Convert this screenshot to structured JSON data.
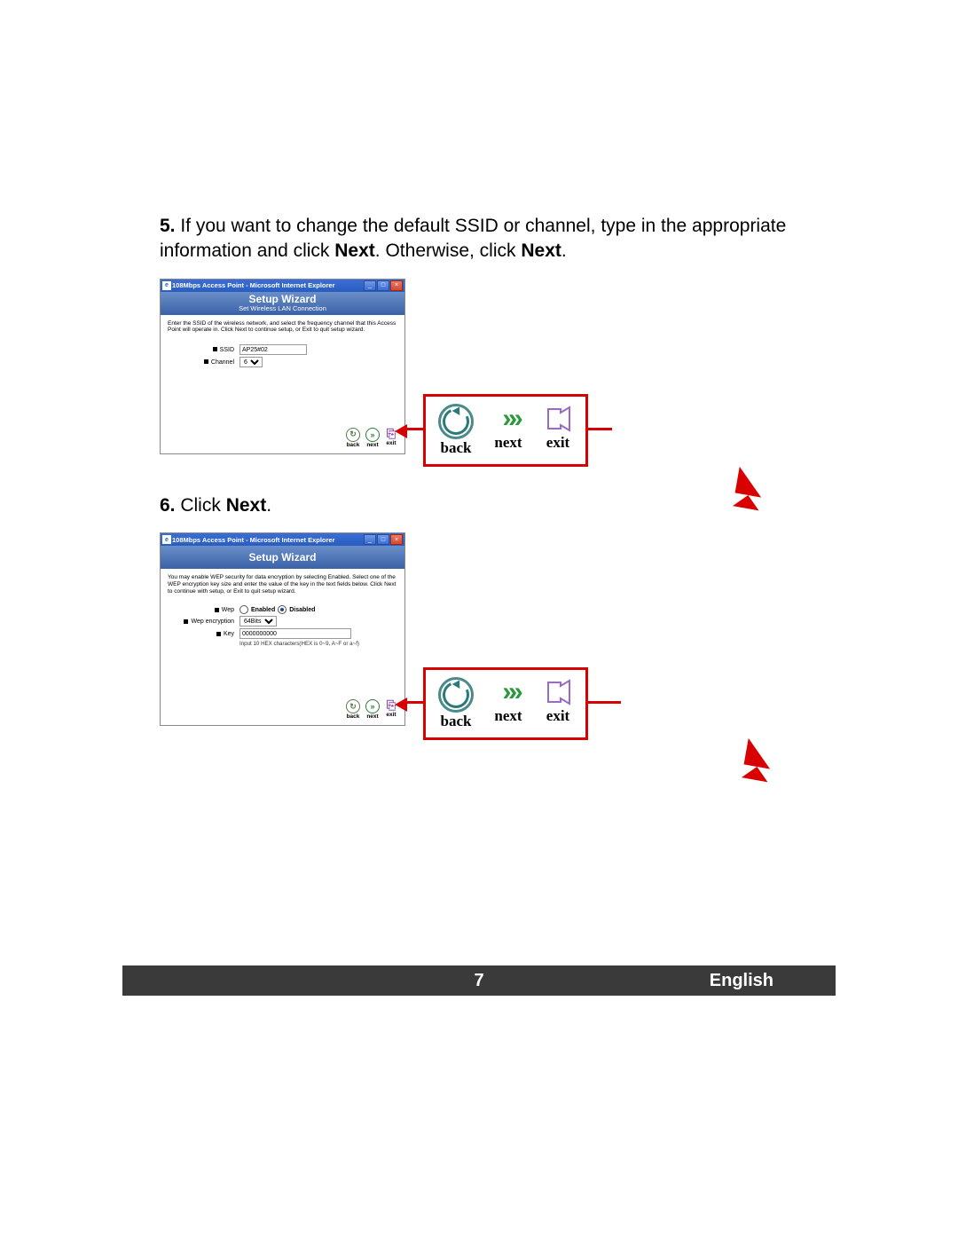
{
  "step5": {
    "number": "5.",
    "text_pre": " If you want to change the default SSID or channel, type in the appropriate information and click ",
    "bold1": "Next",
    "text_mid": ".  Otherwise, click ",
    "bold2": "Next",
    "text_post": "."
  },
  "step6": {
    "number": "6.",
    "text_pre": " Click ",
    "bold1": "Next",
    "text_post": "."
  },
  "browser1": {
    "title": "108Mbps Access Point - Microsoft Internet Explorer",
    "banner_title": "Setup Wizard",
    "banner_sub": "Set Wireless LAN Connection",
    "desc": "Enter the SSID of the wireless network, and select the frequency channel that this Access Point will operate in.\nClick Next to continue setup, or Exit to quit setup wizard.",
    "ssid_label": "SSID",
    "ssid_value": "AP25#02",
    "channel_label": "Channel",
    "channel_value": "6",
    "nav": {
      "back": "back",
      "next": "next",
      "exit": "exit"
    }
  },
  "browser2": {
    "title": "108Mbps Access Point - Microsoft Internet Explorer",
    "banner_title": "Setup Wizard",
    "desc": "You may enable WEP security for data encryption by selecting Enabled. Select one of the WEP encryption key size and enter the value of the key in the text fields below.\nClick Next to continue with setup, or Exit to quit setup wizard.",
    "wep_label": "Wep",
    "wep_enabled": "Enabled",
    "wep_disabled": "Disabled",
    "wep_selected": "Disabled",
    "enc_label": "Wep encryption",
    "enc_value": "64Bits",
    "key_label": "Key",
    "key_value": "0000000000",
    "key_hint": "Input 10 HEX characters(HEX is 0~9, A~F or a~f)",
    "nav": {
      "back": "back",
      "next": "next",
      "exit": "exit"
    }
  },
  "callout_labels": {
    "back": "back",
    "next": "next",
    "exit": "exit"
  },
  "footer": {
    "page": "7",
    "language": "English"
  }
}
